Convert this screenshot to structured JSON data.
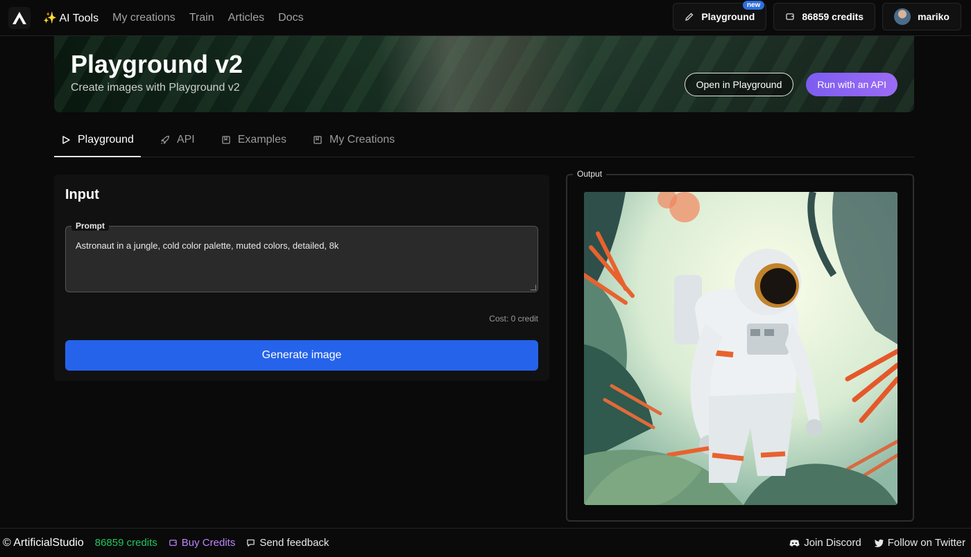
{
  "nav": {
    "links": [
      {
        "label": "✨ AI Tools"
      },
      {
        "label": "My creations"
      },
      {
        "label": "Train"
      },
      {
        "label": "Articles"
      },
      {
        "label": "Docs"
      }
    ],
    "playground_label": "Playground",
    "new_badge": "new",
    "credits_label": "86859 credits",
    "user_name": "mariko"
  },
  "hero": {
    "title": "Playground v2",
    "subtitle": "Create images with Playground v2",
    "open_button": "Open in Playground",
    "api_button": "Run with an API"
  },
  "tabs": [
    {
      "label": "Playground",
      "icon": "play-icon"
    },
    {
      "label": "API",
      "icon": "rocket-icon"
    },
    {
      "label": "Examples",
      "icon": "bookmark-icon"
    },
    {
      "label": "My Creations",
      "icon": "bookmark-icon"
    }
  ],
  "input": {
    "title": "Input",
    "prompt_label": "Prompt",
    "prompt_value": "Astronaut in a jungle, cold color palette, muted colors, detailed, 8k",
    "cost": "Cost: 0 credit",
    "generate_button": "Generate image"
  },
  "output": {
    "label": "Output",
    "image_subject": "astronaut-in-jungle-illustration"
  },
  "footer": {
    "brand": "© ArtificialStudio",
    "credits": "86859 credits",
    "buy_credits": "Buy Credits",
    "feedback": "Send feedback",
    "discord": "Join Discord",
    "twitter": "Follow on Twitter"
  },
  "colors": {
    "accent_blue": "#2563eb",
    "accent_purple": "#9b6cf5",
    "credits_green": "#22c55e",
    "buy_purple": "#c084fc"
  }
}
